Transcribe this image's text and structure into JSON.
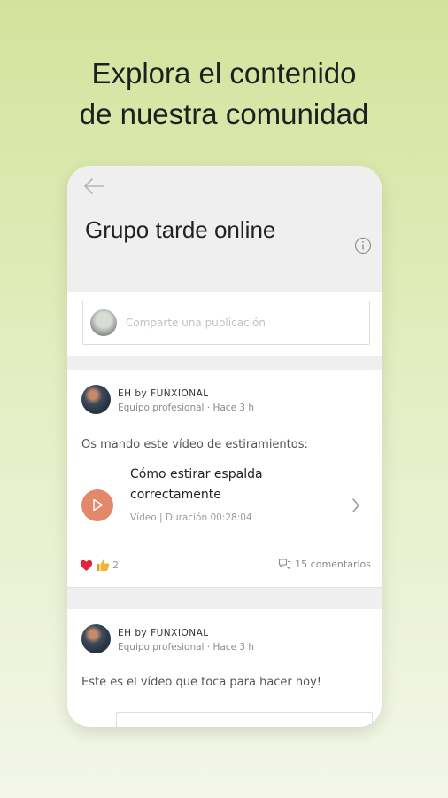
{
  "promo": {
    "line1": "Explora el contenido",
    "line2": "de nuestra comunidad"
  },
  "header": {
    "back_icon": "arrow-left-icon",
    "title": "Grupo tarde online",
    "info_icon": "info-icon"
  },
  "composer": {
    "placeholder": "Comparte una publicación"
  },
  "posts": [
    {
      "author": "EH by FUNXIONAL",
      "role": "Equipo profesional · Hace 3 h",
      "text": "Os mando este vídeo de estiramientos:",
      "video": {
        "title": "Cómo estirar espalda correctamente",
        "subtitle": "Vídeo | Duración 00:28:04"
      },
      "reactions": {
        "icons": [
          "heart-icon",
          "thumbs-up-icon"
        ],
        "count": "2"
      },
      "comments": "15 comentarios"
    },
    {
      "author": "EH by FUNXIONAL",
      "role": "Equipo profesional · Hace 3 h",
      "text": "Este es el vídeo que toca para hacer hoy!"
    }
  ],
  "colors": {
    "accent_play": "#e2896c",
    "heart": "#e0243a",
    "thumb": "#f2b530"
  }
}
